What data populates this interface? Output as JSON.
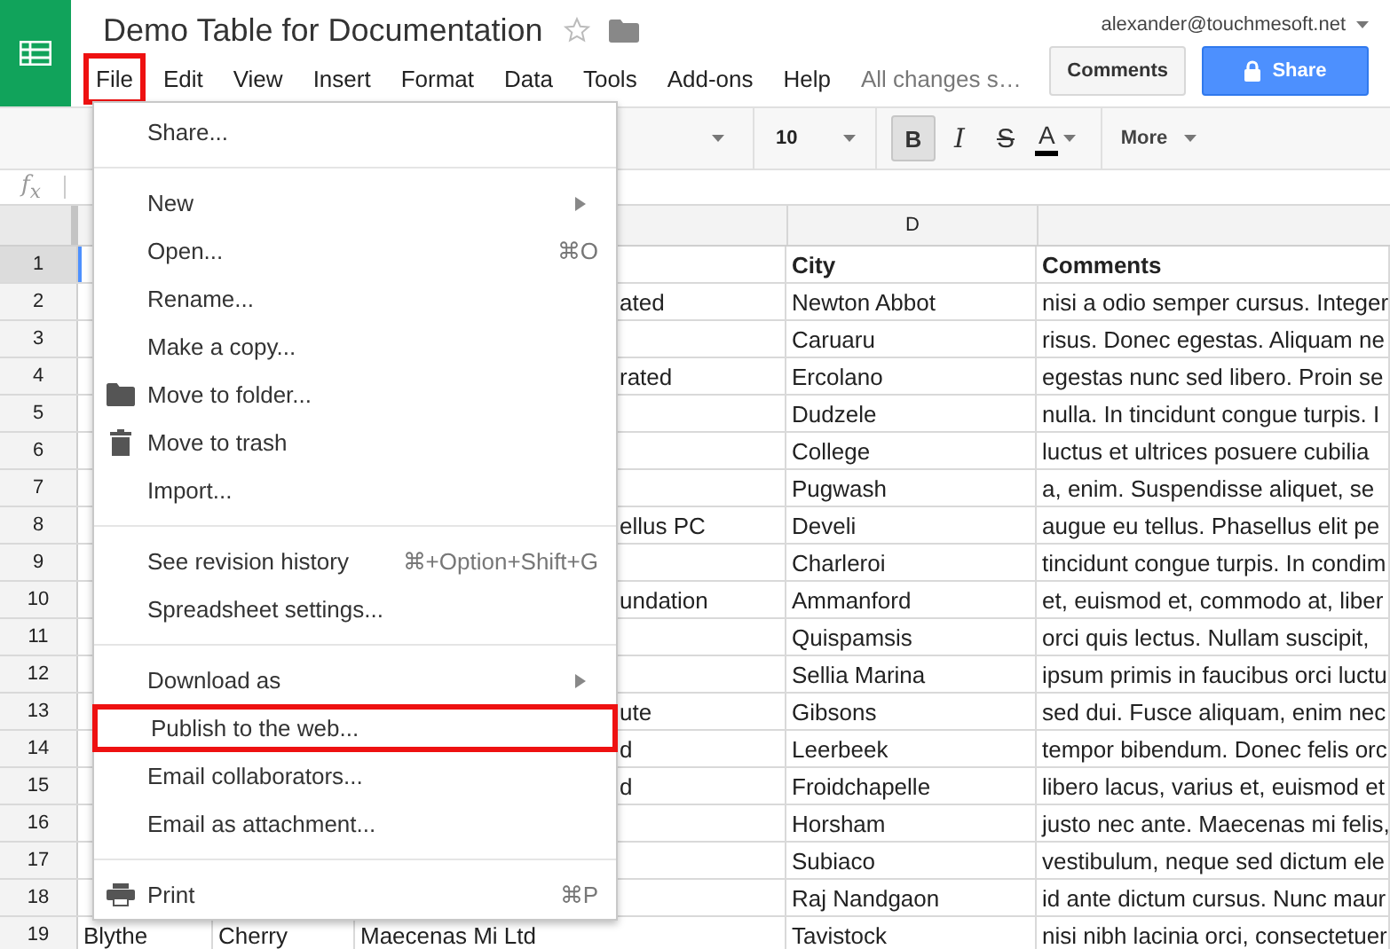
{
  "header": {
    "title": "Demo Table for Documentation",
    "account": "alexander@touchmesoft.net",
    "save_status": "All changes s…",
    "buttons": [
      {
        "label": "Comments",
        "kind": "plain"
      },
      {
        "label": "Share",
        "kind": "primary"
      }
    ]
  },
  "menubar": [
    {
      "label": "File",
      "highlighted": true
    },
    {
      "label": "Edit",
      "highlighted": false
    },
    {
      "label": "View",
      "highlighted": false
    },
    {
      "label": "Insert",
      "highlighted": false
    },
    {
      "label": "Format",
      "highlighted": false
    },
    {
      "label": "Data",
      "highlighted": false
    },
    {
      "label": "Tools",
      "highlighted": false
    },
    {
      "label": "Add-ons",
      "highlighted": false
    },
    {
      "label": "Help",
      "highlighted": false
    }
  ],
  "toolbar": {
    "font_size": "10",
    "format_buttons": [
      {
        "label": "B",
        "kind": "bold",
        "selected": true
      },
      {
        "label": "I",
        "kind": "italic",
        "selected": false
      },
      {
        "label": "S",
        "kind": "strike",
        "selected": false
      },
      {
        "label": "A",
        "kind": "color",
        "selected": false
      }
    ],
    "more": "More"
  },
  "formula_bar": {
    "label": "f$_{x}$"
  },
  "sheet": {
    "columns": [
      {
        "label": "D"
      }
    ],
    "rows": [
      {
        "number": "1",
        "selected": true,
        "bold": true,
        "column_d": "City",
        "column_e": "Comments"
      },
      {
        "number": "2",
        "selected": false,
        "bold": false,
        "column_c": "ated",
        "column_d": "Newton Abbot",
        "column_e": "nisi a odio semper cursus. Integer"
      },
      {
        "number": "3",
        "selected": false,
        "bold": false,
        "column_d": "Caruaru",
        "column_e": "risus. Donec egestas. Aliquam ne"
      },
      {
        "number": "4",
        "selected": false,
        "bold": false,
        "column_c": "rated",
        "column_d": "Ercolano",
        "column_e": "egestas nunc sed libero. Proin se"
      },
      {
        "number": "5",
        "selected": false,
        "bold": false,
        "column_d": "Dudzele",
        "column_e": "nulla. In tincidunt congue turpis. I"
      },
      {
        "number": "6",
        "selected": false,
        "bold": false,
        "column_d": "College",
        "column_e": "luctus et ultrices posuere cubilia"
      },
      {
        "number": "7",
        "selected": false,
        "bold": false,
        "column_d": "Pugwash",
        "column_e": "a, enim. Suspendisse aliquet, se"
      },
      {
        "number": "8",
        "selected": false,
        "bold": false,
        "column_c": "ellus PC",
        "column_d": "Develi",
        "column_e": "augue eu tellus. Phasellus elit pe"
      },
      {
        "number": "9",
        "selected": false,
        "bold": false,
        "column_d": "Charleroi",
        "column_e": "tincidunt congue turpis. In condim"
      },
      {
        "number": "10",
        "selected": false,
        "bold": false,
        "column_c": "undation",
        "column_d": "Ammanford",
        "column_e": "et, euismod et, commodo at, liber"
      },
      {
        "number": "11",
        "selected": false,
        "bold": false,
        "column_d": "Quispamsis",
        "column_e": "orci quis lectus. Nullam suscipit,"
      },
      {
        "number": "12",
        "selected": false,
        "bold": false,
        "column_d": "Sellia Marina",
        "column_e": "ipsum primis in faucibus orci luctu"
      },
      {
        "number": "13",
        "selected": false,
        "bold": false,
        "column_c": "ute",
        "column_d": "Gibsons",
        "column_e": "sed dui. Fusce aliquam, enim nec"
      },
      {
        "number": "14",
        "selected": false,
        "bold": false,
        "column_c": "d",
        "column_d": "Leerbeek",
        "column_e": "tempor bibendum. Donec felis orc"
      },
      {
        "number": "15",
        "selected": false,
        "bold": false,
        "column_c": "d",
        "column_d": "Froidchapelle",
        "column_e": "libero lacus, varius et, euismod et"
      },
      {
        "number": "16",
        "selected": false,
        "bold": false,
        "column_d": "Horsham",
        "column_e": "justo nec ante. Maecenas mi felis,"
      },
      {
        "number": "17",
        "selected": false,
        "bold": false,
        "column_d": "Subiaco",
        "column_e": "vestibulum, neque sed dictum ele"
      },
      {
        "number": "18",
        "selected": false,
        "bold": false,
        "column_d": "Raj Nandgaon",
        "column_e": "id ante dictum cursus. Nunc maur"
      },
      {
        "number": "19",
        "selected": false,
        "bold": false,
        "column_a": "Blythe",
        "column_b": "Cherry",
        "column_c": "Maecenas Mi Ltd",
        "column_d": "Tavistock",
        "column_e": "nisi nibh lacinia orci, consectetuer"
      }
    ]
  },
  "file_menu": [
    {
      "kind": "item",
      "label": "Share...",
      "highlighted": false
    },
    {
      "kind": "separator"
    },
    {
      "kind": "item",
      "label": "New",
      "submenu": true,
      "highlighted": false
    },
    {
      "kind": "item",
      "label": "Open...",
      "shortcut": "⌘O",
      "highlighted": false
    },
    {
      "kind": "item",
      "label": "Rename...",
      "highlighted": false
    },
    {
      "kind": "item",
      "label": "Make a copy...",
      "highlighted": false
    },
    {
      "kind": "folder",
      "label": "Move to folder...",
      "highlighted": false
    },
    {
      "kind": "trash",
      "label": "Move to trash",
      "highlighted": false
    },
    {
      "kind": "item",
      "label": "Import...",
      "highlighted": false
    },
    {
      "kind": "separator"
    },
    {
      "kind": "item",
      "label": "See revision history",
      "shortcut": "⌘+Option+Shift+G",
      "highlighted": false
    },
    {
      "kind": "item",
      "label": "Spreadsheet settings...",
      "highlighted": false
    },
    {
      "kind": "separator"
    },
    {
      "kind": "item",
      "label": "Download as",
      "submenu": true,
      "highlighted": false
    },
    {
      "kind": "item",
      "label": "Publish to the web...",
      "highlighted": true
    },
    {
      "kind": "item",
      "label": "Email collaborators...",
      "highlighted": false
    },
    {
      "kind": "item",
      "label": "Email as attachment...",
      "highlighted": false
    },
    {
      "kind": "separator"
    },
    {
      "kind": "print",
      "label": "Print",
      "shortcut": "⌘P",
      "highlighted": false
    }
  ]
}
